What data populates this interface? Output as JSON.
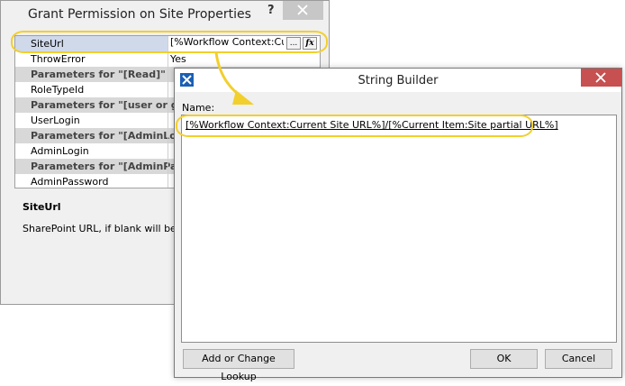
{
  "properties_dialog": {
    "title": "Grant Permission on Site Properties",
    "help_glyph": "?",
    "rows": [
      {
        "key": "SiteUrl",
        "value": "[%Workflow Context:Current Site URL%]/[%Current Item:Site partial URL%]",
        "type": "item"
      },
      {
        "key": "ThrowError",
        "value": "Yes",
        "type": "item"
      },
      {
        "key": "Parameters for \"[Read]\"",
        "value": "",
        "type": "section"
      },
      {
        "key": "RoleTypeId",
        "value": "",
        "type": "item"
      },
      {
        "key": "Parameters for \"[user or group]\"",
        "value": "",
        "type": "section"
      },
      {
        "key": "UserLogin",
        "value": "",
        "type": "item"
      },
      {
        "key": "Parameters for \"[AdminLogin]\"",
        "value": "",
        "type": "section"
      },
      {
        "key": "AdminLogin",
        "value": "",
        "type": "item"
      },
      {
        "key": "Parameters for \"[AdminPassword]\"",
        "value": "",
        "type": "section"
      },
      {
        "key": "AdminPassword",
        "value": "",
        "type": "item"
      }
    ],
    "site_url_shown": "[%Workflow Context:Cur",
    "ellipsis_button": "...",
    "fx_button": "fx",
    "description_title": "SiteUrl",
    "description_text": "SharePoint URL, if blank will be"
  },
  "string_builder": {
    "title": "String Builder",
    "name_label": "Name:",
    "value": "[%Workflow Context:Current Site URL%]/[%Current Item:Site partial URL%]",
    "add_lookup_label": "Add or Change Lookup",
    "ok_label": "OK",
    "cancel_label": "Cancel"
  },
  "colors": {
    "highlight": "#f2cf2c",
    "close_red": "#c75050",
    "section_bg": "#d8d8d8",
    "selected_row": "#cfd9ea"
  }
}
